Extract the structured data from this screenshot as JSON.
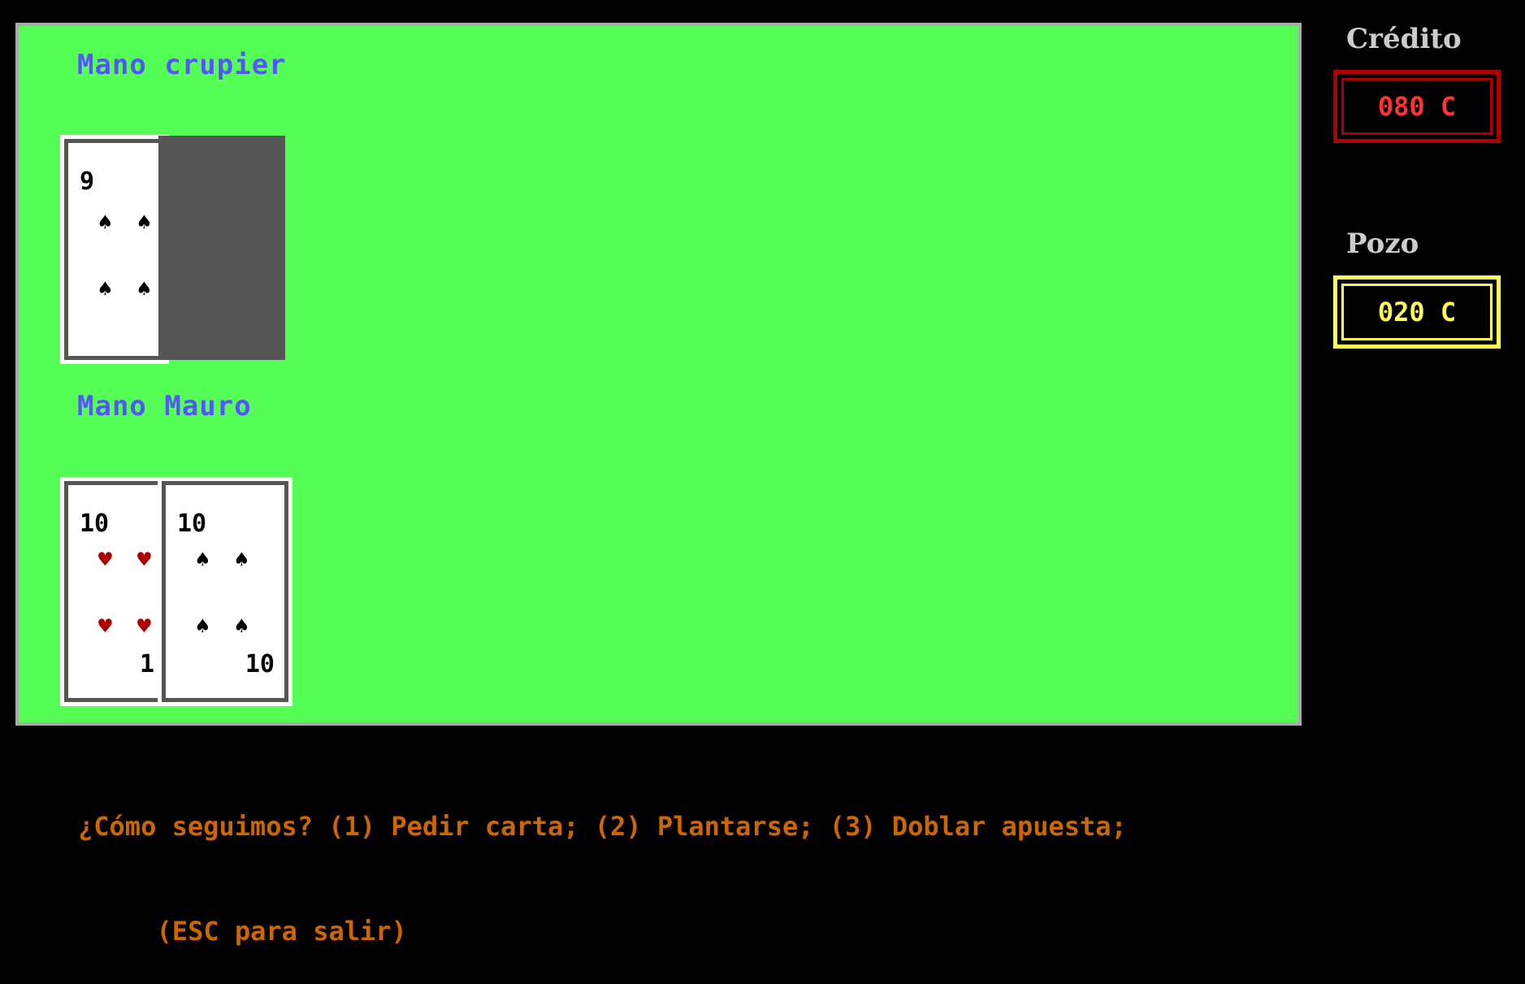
{
  "dealer": {
    "label": "Mano crupier",
    "cards": [
      {
        "rank": "9",
        "suit": "spade",
        "face": "up"
      },
      {
        "face": "down"
      }
    ]
  },
  "player": {
    "label": "Mano Mauro",
    "cards": [
      {
        "rank": "10",
        "rank_bottom": "1",
        "suit": "heart",
        "face": "up"
      },
      {
        "rank": "10",
        "rank_bottom": "10",
        "suit": "spade",
        "face": "up"
      }
    ]
  },
  "credit": {
    "label": "Crédito",
    "value": "080 C"
  },
  "pot": {
    "label": "Pozo",
    "value": "020 C"
  },
  "prompt": {
    "line1": "¿Cómo seguimos? (1) Pedir carta; (2) Plantarse; (3) Doblar apuesta;",
    "line2": "  (ESC para salir)"
  },
  "icons": {
    "spade": "♠",
    "heart": "♥"
  },
  "colors": {
    "table": "#55ff55",
    "label": "#5555ff",
    "credit": "#aa0000",
    "pot": "#ffff55",
    "prompt": "#cc6600"
  }
}
